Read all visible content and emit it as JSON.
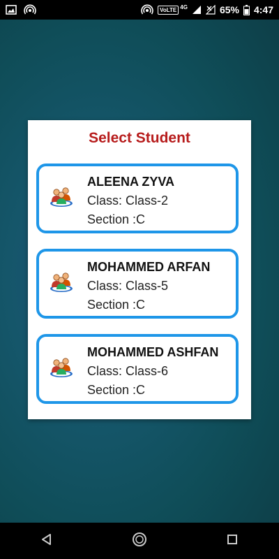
{
  "status_bar": {
    "left_icons": [
      "image-icon",
      "hotspot-icon"
    ],
    "right_icons": [
      "hotspot-icon",
      "volte-icon",
      "signal-icon",
      "no-signal-icon",
      "battery-icon"
    ],
    "volte": "VoLTE",
    "network": "4G",
    "battery": "65%",
    "time": "4:47"
  },
  "dialog": {
    "title": "Select Student",
    "students": [
      {
        "name": "ALEENA ZYVA",
        "class": "Class: Class-2",
        "section": "Section :C",
        "icon": "students-icon"
      },
      {
        "name": "MOHAMMED ARFAN",
        "class": "Class: Class-5",
        "section": "Section :C",
        "icon": "students-icon"
      },
      {
        "name": "MOHAMMED ASHFAN",
        "class": "Class: Class-6",
        "section": "Section :C",
        "icon": "students-icon"
      }
    ]
  },
  "nav_bar": {
    "buttons": [
      "back-icon",
      "home-icon",
      "recents-icon"
    ]
  },
  "colors": {
    "title": "#b71c1c",
    "card_border": "#1e96e8"
  }
}
